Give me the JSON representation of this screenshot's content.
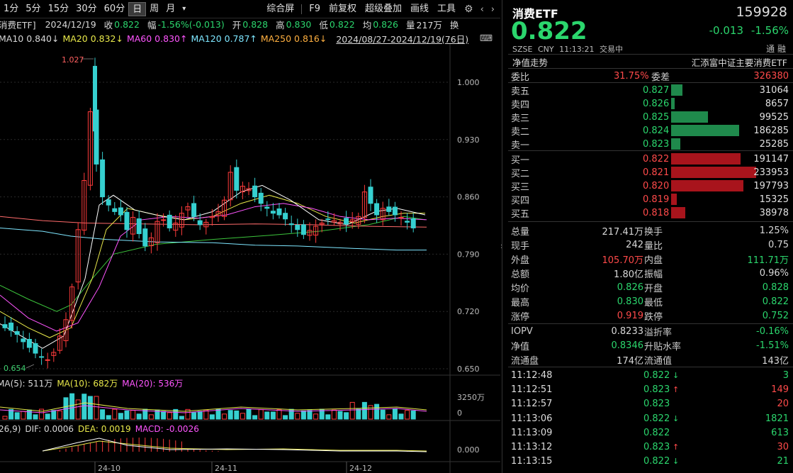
{
  "toolbar": {
    "periods": [
      "1分",
      "5分",
      "15分",
      "30分",
      "60分",
      "日",
      "周",
      "月"
    ],
    "active_period": "日",
    "dropdown": "▾",
    "tools": [
      "综合屏",
      "F9",
      "前复权",
      "超级叠加",
      "画线",
      "工具"
    ]
  },
  "info": {
    "name": "消费ETF]",
    "date": "2024/12/19",
    "close_label": "收",
    "close": "0.822",
    "amp_label": "幅",
    "amp": "-1.56%(-0.013)",
    "open_label": "开",
    "open": "0.828",
    "high_label": "高",
    "high": "0.830",
    "low_label": "低",
    "low": "0.822",
    "avg_label": "均",
    "avg": "0.826",
    "vol_label": "量",
    "vol": "217万",
    "switch_label": "换",
    "ma10": "MA10 0.840↓",
    "ma20": "MA20 0.832↓",
    "ma60": "MA60 0.830↑",
    "ma120": "MA120 0.787↑",
    "ma250": "MA250 0.816↓",
    "range": "2024/08/27-2024/12/19(76日)"
  },
  "volume": {
    "ma5": "MA(5): 511万",
    "ma10": "MA(10): 682万",
    "ma20": "MA(20): 536万",
    "axis_top": "3250万",
    "axis_zero": "0"
  },
  "macd": {
    "params": "26,9)",
    "dif": "DIF: 0.0006",
    "dea": "DEA: 0.0019",
    "macd": "MACD: -0.0026",
    "axis": "0.000"
  },
  "chart_data": {
    "type": "candlestick",
    "y_ticks": [
      "1.000",
      "0.930",
      "0.860",
      "0.790",
      "0.720",
      "0.650"
    ],
    "ylim": [
      0.65,
      1.0
    ],
    "x_labels": [
      "24-10",
      "24-11",
      "24-12"
    ],
    "annotations": {
      "high": "1.027",
      "low": "0.654"
    },
    "colors": {
      "up": "#ff3b3b",
      "down": "#36d0d0"
    }
  },
  "right": {
    "title": "消费ETF",
    "code": "159928",
    "price": "0.822",
    "change": "-0.013",
    "change_pct": "-1.56%",
    "exchange": "SZSE",
    "currency": "CNY",
    "time": "11:13:21",
    "status": "交易中",
    "icons_label": "通 融",
    "nav_trend": "净值走势",
    "fund_name": "汇添富中证主要消费ETF",
    "webi_label": "委比",
    "webi": "31.75%",
    "wecha_label": "委差",
    "wecha": "326380",
    "asks": [
      {
        "label": "卖五",
        "price": "0.827",
        "vol": "31064",
        "frac": 0.13
      },
      {
        "label": "卖四",
        "price": "0.826",
        "vol": "8657",
        "frac": 0.04
      },
      {
        "label": "卖三",
        "price": "0.825",
        "vol": "99525",
        "frac": 0.43
      },
      {
        "label": "卖二",
        "price": "0.824",
        "vol": "186285",
        "frac": 0.8
      },
      {
        "label": "卖一",
        "price": "0.823",
        "vol": "25285",
        "frac": 0.11
      }
    ],
    "bids": [
      {
        "label": "买一",
        "price": "0.822",
        "vol": "191147",
        "frac": 0.82
      },
      {
        "label": "买二",
        "price": "0.821",
        "vol": "233953",
        "frac": 1.0
      },
      {
        "label": "买三",
        "price": "0.820",
        "vol": "197793",
        "frac": 0.85
      },
      {
        "label": "买四",
        "price": "0.819",
        "vol": "15325",
        "frac": 0.07
      },
      {
        "label": "买五",
        "price": "0.818",
        "vol": "38978",
        "frac": 0.17
      }
    ],
    "stats": [
      {
        "l1": "总量",
        "v1": "217.41万",
        "c1": "w",
        "l2": "换手",
        "v2": "1.25%",
        "c2": "w"
      },
      {
        "l1": "现手",
        "v1": "242",
        "c1": "w",
        "l2": "量比",
        "v2": "0.75",
        "c2": "w"
      },
      {
        "l1": "外盘",
        "v1": "105.70万",
        "c1": "r",
        "l2": "内盘",
        "v2": "111.71万",
        "c2": "g"
      },
      {
        "l1": "总额",
        "v1": "1.80亿",
        "c1": "w",
        "l2": "振幅",
        "v2": "0.96%",
        "c2": "w"
      },
      {
        "l1": "均价",
        "v1": "0.826",
        "c1": "g",
        "l2": "开盘",
        "v2": "0.828",
        "c2": "g"
      },
      {
        "l1": "最高",
        "v1": "0.830",
        "c1": "g",
        "l2": "最低",
        "v2": "0.822",
        "c2": "g"
      },
      {
        "l1": "涨停",
        "v1": "0.919",
        "c1": "r",
        "l2": "跌停",
        "v2": "0.752",
        "c2": "g"
      }
    ],
    "stats2": [
      {
        "l1": "IOPV",
        "v1": "0.8233",
        "c1": "w",
        "l2": "溢折率",
        "v2": "-0.16%",
        "c2": "g"
      },
      {
        "l1": "净值",
        "v1": "0.8346",
        "c1": "g",
        "l2": "升贴水率",
        "v2": "-1.51%",
        "c2": "g"
      },
      {
        "l1": "流通盘",
        "v1": "174亿",
        "c1": "w",
        "l2": "流通值",
        "v2": "143亿",
        "c2": "w"
      }
    ],
    "ticks": [
      {
        "time": "11:12:48",
        "price": "0.822",
        "dir": "down",
        "vol": "3",
        "vc": "g"
      },
      {
        "time": "11:12:51",
        "price": "0.823",
        "dir": "up",
        "vol": "149",
        "vc": "r"
      },
      {
        "time": "11:12:57",
        "price": "0.823",
        "dir": "",
        "vol": "20",
        "vc": "r"
      },
      {
        "time": "11:13:06",
        "price": "0.822",
        "dir": "down",
        "vol": "1821",
        "vc": "g"
      },
      {
        "time": "11:13:09",
        "price": "0.822",
        "dir": "",
        "vol": "613",
        "vc": "g"
      },
      {
        "time": "11:13:12",
        "price": "0.823",
        "dir": "up",
        "vol": "30",
        "vc": "r"
      },
      {
        "time": "11:13:15",
        "price": "0.822",
        "dir": "down",
        "vol": "21",
        "vc": "g"
      }
    ]
  }
}
